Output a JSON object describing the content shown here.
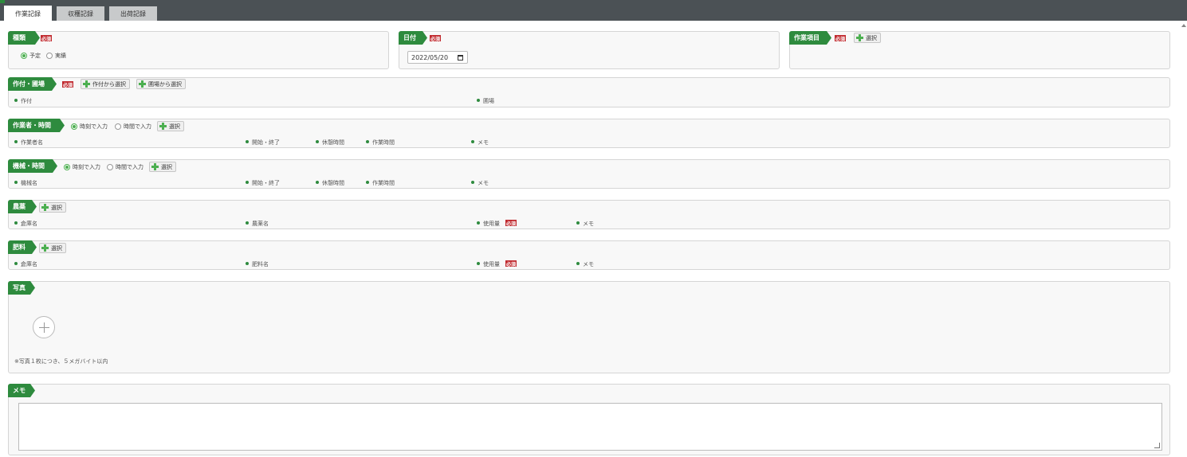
{
  "tabs": {
    "work": "作業記録",
    "harvest": "収穫記録",
    "shipping": "出荷記録"
  },
  "required_label": "必須",
  "select_label": "選択",
  "type": {
    "title": "種類",
    "options": {
      "planned": "予定",
      "actual": "実績"
    },
    "selected": "予定"
  },
  "date": {
    "title": "日付",
    "value": "2022/05/20"
  },
  "work_item": {
    "title": "作業項目"
  },
  "crop_field": {
    "title": "作付・圃場",
    "btn_from_crop": "作付から選択",
    "btn_from_field": "圃場から選択",
    "col_crop": "作付",
    "col_field": "圃場"
  },
  "worker_time": {
    "title": "作業者・時間",
    "opt_clock": "時刻で入力",
    "opt_duration": "時間で入力",
    "col_name": "作業者名",
    "col_start_end": "開始・終了",
    "col_break": "休憩時間",
    "col_work": "作業時間",
    "col_memo": "メモ"
  },
  "machine_time": {
    "title": "機械・時間",
    "opt_clock": "時刻で入力",
    "opt_duration": "時間で入力",
    "col_name": "機械名",
    "col_start_end": "開始・終了",
    "col_break": "休憩時間",
    "col_work": "作業時間",
    "col_memo": "メモ"
  },
  "pesticide": {
    "title": "農薬",
    "col_warehouse": "倉庫名",
    "col_name": "農薬名",
    "col_amount": "使用量",
    "col_memo": "メモ"
  },
  "fertilizer": {
    "title": "肥料",
    "col_warehouse": "倉庫名",
    "col_name": "肥料名",
    "col_amount": "使用量",
    "col_memo": "メモ"
  },
  "photo": {
    "title": "写真",
    "note": "※写真１枚につき、５メガバイト以内"
  },
  "memo": {
    "title": "メモ"
  },
  "colors": {
    "accent_green": "#2e8b3e",
    "required_red": "#c0282d",
    "topbar": "#4b5155"
  }
}
